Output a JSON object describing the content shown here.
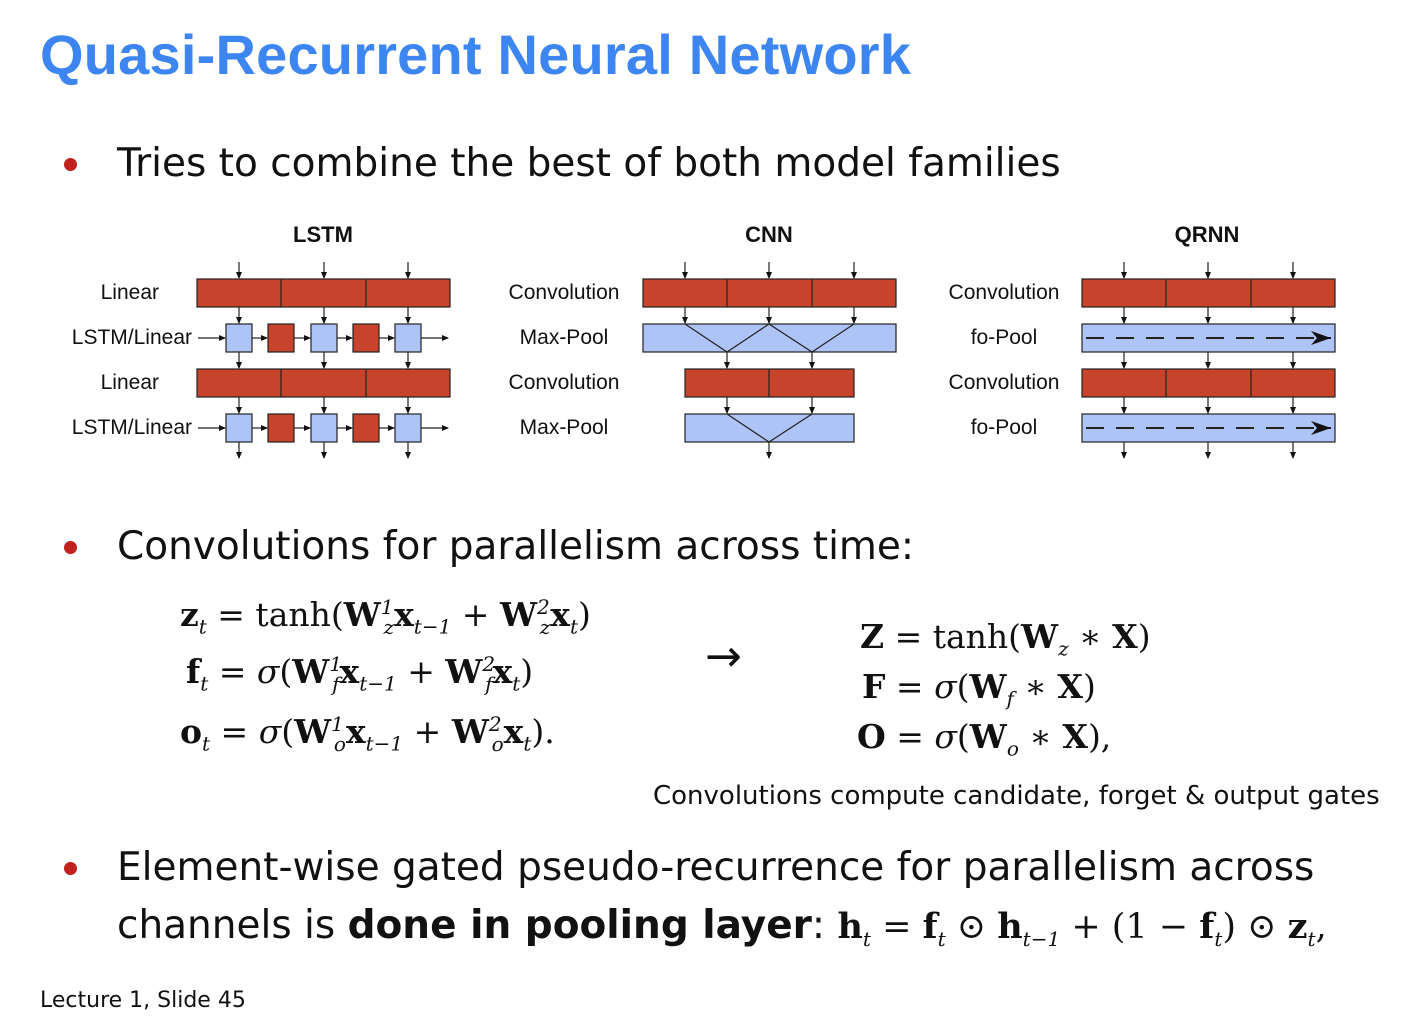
{
  "slide": {
    "title": "Quasi-Recurrent Neural Network",
    "footer": "Lecture 1, Slide 45"
  },
  "bullets": [
    {
      "text": "Tries to combine the best of both model families"
    },
    {
      "text": "Convolutions for parallelism across time:"
    },
    {
      "text_part1": "Element-wise gated pseudo-recurrence for parallelism across",
      "text_part2_plain": "channels is ",
      "text_part2_bold": "done in pooling layer",
      "text_part2_tail": ":"
    }
  ],
  "diagrams": {
    "lstm": {
      "title": "LSTM",
      "rows": [
        "Linear",
        "LSTM/Linear",
        "Linear",
        "LSTM/Linear"
      ]
    },
    "cnn": {
      "title": "CNN",
      "rows": [
        "Convolution",
        "Max-Pool",
        "Convolution",
        "Max-Pool"
      ]
    },
    "qrnn": {
      "title": "QRNN",
      "rows": [
        "Convolution",
        "fo-Pool",
        "Convolution",
        "fo-Pool"
      ]
    }
  },
  "colors": {
    "title": "#3d85f0",
    "bullet": "#c0201e",
    "conv_block": "#c8432b",
    "pool_block": "#aec4f7"
  },
  "equations": {
    "left": [
      {
        "lhs": "z",
        "lhs_sub": "t",
        "rhs": "= tanh(W¹_z x_{t−1} + W²_z x_t)"
      },
      {
        "lhs": "f",
        "lhs_sub": "t",
        "rhs": "= σ(W¹_f x_{t−1} + W²_f x_t)"
      },
      {
        "lhs": "o",
        "lhs_sub": "t",
        "rhs": "= σ(W¹_o x_{t−1} + W²_o x_t)."
      }
    ],
    "arrow": "→",
    "right": [
      {
        "lhs": "Z",
        "rhs": "= tanh(W_z ∗ X)"
      },
      {
        "lhs": "F",
        "rhs": "= σ(W_f ∗ X)"
      },
      {
        "lhs": "O",
        "rhs": "= σ(W_o ∗ X),"
      }
    ],
    "caption": "Convolutions compute candidate, forget & output gates",
    "pooling": "h_t = f_t ⊙ h_{t−1} + (1 − f_t) ⊙ z_t,"
  }
}
